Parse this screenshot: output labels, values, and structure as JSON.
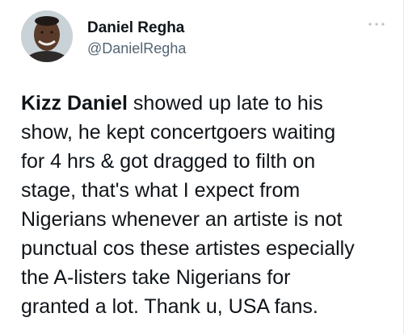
{
  "tweet": {
    "author": {
      "display_name": "Daniel Regha",
      "handle": "@DanielRegha",
      "avatar_icon": "profile-photo"
    },
    "more_icon": "more-horizontal-icon",
    "body": {
      "bold_lead": "Kizz Daniel",
      "line_1_rest": " showed up late to his",
      "lines": [
        "show, he kept concertgoers waiting",
        "for 4 hrs & got dragged to filth on",
        "stage, that's what I expect from",
        "Nigerians whenever an artiste is not",
        "punctual cos these artistes especially",
        "the A-listers take Nigerians for",
        "granted a lot. Thank u, USA fans."
      ]
    }
  },
  "colors": {
    "text_primary": "#0f1419",
    "text_secondary": "#536471",
    "background": "#ffffff"
  }
}
